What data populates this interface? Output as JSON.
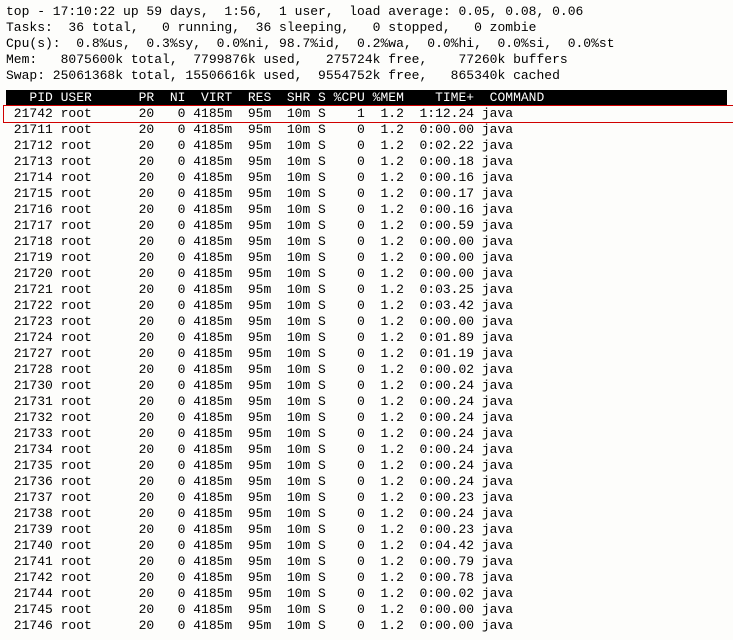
{
  "summary": {
    "line1": "top - 17:10:22 up 59 days,  1:56,  1 user,  load average: 0.05, 0.08, 0.06",
    "line2": "Tasks:  36 total,   0 running,  36 sleeping,   0 stopped,   0 zombie",
    "line3": "Cpu(s):  0.8%us,  0.3%sy,  0.0%ni, 98.7%id,  0.2%wa,  0.0%hi,  0.0%si,  0.0%st",
    "line4": "Mem:   8075600k total,  7799876k used,   275724k free,    77260k buffers",
    "line5": "Swap: 25061368k total, 15506616k used,  9554752k free,   865340k cached"
  },
  "columns": "   PID USER      PR  NI  VIRT  RES  SHR S %CPU %MEM    TIME+  COMMAND           ",
  "highlight_pid": 21742,
  "processes": [
    {
      "pid": 21742,
      "user": "root",
      "pr": 20,
      "ni": 0,
      "virt": "4185m",
      "res": "95m",
      "shr": "10m",
      "s": "S",
      "cpu": "1",
      "mem": "1.2",
      "time": "1:12.24",
      "cmd": "java"
    },
    {
      "pid": 21711,
      "user": "root",
      "pr": 20,
      "ni": 0,
      "virt": "4185m",
      "res": "95m",
      "shr": "10m",
      "s": "S",
      "cpu": "0",
      "mem": "1.2",
      "time": "0:00.00",
      "cmd": "java"
    },
    {
      "pid": 21712,
      "user": "root",
      "pr": 20,
      "ni": 0,
      "virt": "4185m",
      "res": "95m",
      "shr": "10m",
      "s": "S",
      "cpu": "0",
      "mem": "1.2",
      "time": "0:02.22",
      "cmd": "java"
    },
    {
      "pid": 21713,
      "user": "root",
      "pr": 20,
      "ni": 0,
      "virt": "4185m",
      "res": "95m",
      "shr": "10m",
      "s": "S",
      "cpu": "0",
      "mem": "1.2",
      "time": "0:00.18",
      "cmd": "java"
    },
    {
      "pid": 21714,
      "user": "root",
      "pr": 20,
      "ni": 0,
      "virt": "4185m",
      "res": "95m",
      "shr": "10m",
      "s": "S",
      "cpu": "0",
      "mem": "1.2",
      "time": "0:00.16",
      "cmd": "java"
    },
    {
      "pid": 21715,
      "user": "root",
      "pr": 20,
      "ni": 0,
      "virt": "4185m",
      "res": "95m",
      "shr": "10m",
      "s": "S",
      "cpu": "0",
      "mem": "1.2",
      "time": "0:00.17",
      "cmd": "java"
    },
    {
      "pid": 21716,
      "user": "root",
      "pr": 20,
      "ni": 0,
      "virt": "4185m",
      "res": "95m",
      "shr": "10m",
      "s": "S",
      "cpu": "0",
      "mem": "1.2",
      "time": "0:00.16",
      "cmd": "java"
    },
    {
      "pid": 21717,
      "user": "root",
      "pr": 20,
      "ni": 0,
      "virt": "4185m",
      "res": "95m",
      "shr": "10m",
      "s": "S",
      "cpu": "0",
      "mem": "1.2",
      "time": "0:00.59",
      "cmd": "java"
    },
    {
      "pid": 21718,
      "user": "root",
      "pr": 20,
      "ni": 0,
      "virt": "4185m",
      "res": "95m",
      "shr": "10m",
      "s": "S",
      "cpu": "0",
      "mem": "1.2",
      "time": "0:00.00",
      "cmd": "java"
    },
    {
      "pid": 21719,
      "user": "root",
      "pr": 20,
      "ni": 0,
      "virt": "4185m",
      "res": "95m",
      "shr": "10m",
      "s": "S",
      "cpu": "0",
      "mem": "1.2",
      "time": "0:00.00",
      "cmd": "java"
    },
    {
      "pid": 21720,
      "user": "root",
      "pr": 20,
      "ni": 0,
      "virt": "4185m",
      "res": "95m",
      "shr": "10m",
      "s": "S",
      "cpu": "0",
      "mem": "1.2",
      "time": "0:00.00",
      "cmd": "java"
    },
    {
      "pid": 21721,
      "user": "root",
      "pr": 20,
      "ni": 0,
      "virt": "4185m",
      "res": "95m",
      "shr": "10m",
      "s": "S",
      "cpu": "0",
      "mem": "1.2",
      "time": "0:03.25",
      "cmd": "java"
    },
    {
      "pid": 21722,
      "user": "root",
      "pr": 20,
      "ni": 0,
      "virt": "4185m",
      "res": "95m",
      "shr": "10m",
      "s": "S",
      "cpu": "0",
      "mem": "1.2",
      "time": "0:03.42",
      "cmd": "java"
    },
    {
      "pid": 21723,
      "user": "root",
      "pr": 20,
      "ni": 0,
      "virt": "4185m",
      "res": "95m",
      "shr": "10m",
      "s": "S",
      "cpu": "0",
      "mem": "1.2",
      "time": "0:00.00",
      "cmd": "java"
    },
    {
      "pid": 21724,
      "user": "root",
      "pr": 20,
      "ni": 0,
      "virt": "4185m",
      "res": "95m",
      "shr": "10m",
      "s": "S",
      "cpu": "0",
      "mem": "1.2",
      "time": "0:01.89",
      "cmd": "java"
    },
    {
      "pid": 21727,
      "user": "root",
      "pr": 20,
      "ni": 0,
      "virt": "4185m",
      "res": "95m",
      "shr": "10m",
      "s": "S",
      "cpu": "0",
      "mem": "1.2",
      "time": "0:01.19",
      "cmd": "java"
    },
    {
      "pid": 21728,
      "user": "root",
      "pr": 20,
      "ni": 0,
      "virt": "4185m",
      "res": "95m",
      "shr": "10m",
      "s": "S",
      "cpu": "0",
      "mem": "1.2",
      "time": "0:00.02",
      "cmd": "java"
    },
    {
      "pid": 21730,
      "user": "root",
      "pr": 20,
      "ni": 0,
      "virt": "4185m",
      "res": "95m",
      "shr": "10m",
      "s": "S",
      "cpu": "0",
      "mem": "1.2",
      "time": "0:00.24",
      "cmd": "java"
    },
    {
      "pid": 21731,
      "user": "root",
      "pr": 20,
      "ni": 0,
      "virt": "4185m",
      "res": "95m",
      "shr": "10m",
      "s": "S",
      "cpu": "0",
      "mem": "1.2",
      "time": "0:00.24",
      "cmd": "java"
    },
    {
      "pid": 21732,
      "user": "root",
      "pr": 20,
      "ni": 0,
      "virt": "4185m",
      "res": "95m",
      "shr": "10m",
      "s": "S",
      "cpu": "0",
      "mem": "1.2",
      "time": "0:00.24",
      "cmd": "java"
    },
    {
      "pid": 21733,
      "user": "root",
      "pr": 20,
      "ni": 0,
      "virt": "4185m",
      "res": "95m",
      "shr": "10m",
      "s": "S",
      "cpu": "0",
      "mem": "1.2",
      "time": "0:00.24",
      "cmd": "java"
    },
    {
      "pid": 21734,
      "user": "root",
      "pr": 20,
      "ni": 0,
      "virt": "4185m",
      "res": "95m",
      "shr": "10m",
      "s": "S",
      "cpu": "0",
      "mem": "1.2",
      "time": "0:00.24",
      "cmd": "java"
    },
    {
      "pid": 21735,
      "user": "root",
      "pr": 20,
      "ni": 0,
      "virt": "4185m",
      "res": "95m",
      "shr": "10m",
      "s": "S",
      "cpu": "0",
      "mem": "1.2",
      "time": "0:00.24",
      "cmd": "java"
    },
    {
      "pid": 21736,
      "user": "root",
      "pr": 20,
      "ni": 0,
      "virt": "4185m",
      "res": "95m",
      "shr": "10m",
      "s": "S",
      "cpu": "0",
      "mem": "1.2",
      "time": "0:00.24",
      "cmd": "java"
    },
    {
      "pid": 21737,
      "user": "root",
      "pr": 20,
      "ni": 0,
      "virt": "4185m",
      "res": "95m",
      "shr": "10m",
      "s": "S",
      "cpu": "0",
      "mem": "1.2",
      "time": "0:00.23",
      "cmd": "java"
    },
    {
      "pid": 21738,
      "user": "root",
      "pr": 20,
      "ni": 0,
      "virt": "4185m",
      "res": "95m",
      "shr": "10m",
      "s": "S",
      "cpu": "0",
      "mem": "1.2",
      "time": "0:00.24",
      "cmd": "java"
    },
    {
      "pid": 21739,
      "user": "root",
      "pr": 20,
      "ni": 0,
      "virt": "4185m",
      "res": "95m",
      "shr": "10m",
      "s": "S",
      "cpu": "0",
      "mem": "1.2",
      "time": "0:00.23",
      "cmd": "java"
    },
    {
      "pid": 21740,
      "user": "root",
      "pr": 20,
      "ni": 0,
      "virt": "4185m",
      "res": "95m",
      "shr": "10m",
      "s": "S",
      "cpu": "0",
      "mem": "1.2",
      "time": "0:04.42",
      "cmd": "java"
    },
    {
      "pid": 21741,
      "user": "root",
      "pr": 20,
      "ni": 0,
      "virt": "4185m",
      "res": "95m",
      "shr": "10m",
      "s": "S",
      "cpu": "0",
      "mem": "1.2",
      "time": "0:00.79",
      "cmd": "java"
    },
    {
      "pid": 21742,
      "user": "root",
      "pr": 20,
      "ni": 0,
      "virt": "4185m",
      "res": "95m",
      "shr": "10m",
      "s": "S",
      "cpu": "0",
      "mem": "1.2",
      "time": "0:00.78",
      "cmd": "java"
    },
    {
      "pid": 21744,
      "user": "root",
      "pr": 20,
      "ni": 0,
      "virt": "4185m",
      "res": "95m",
      "shr": "10m",
      "s": "S",
      "cpu": "0",
      "mem": "1.2",
      "time": "0:00.02",
      "cmd": "java"
    },
    {
      "pid": 21745,
      "user": "root",
      "pr": 20,
      "ni": 0,
      "virt": "4185m",
      "res": "95m",
      "shr": "10m",
      "s": "S",
      "cpu": "0",
      "mem": "1.2",
      "time": "0:00.00",
      "cmd": "java"
    },
    {
      "pid": 21746,
      "user": "root",
      "pr": 20,
      "ni": 0,
      "virt": "4185m",
      "res": "95m",
      "shr": "10m",
      "s": "S",
      "cpu": "0",
      "mem": "1.2",
      "time": "0:00.00",
      "cmd": "java"
    }
  ]
}
